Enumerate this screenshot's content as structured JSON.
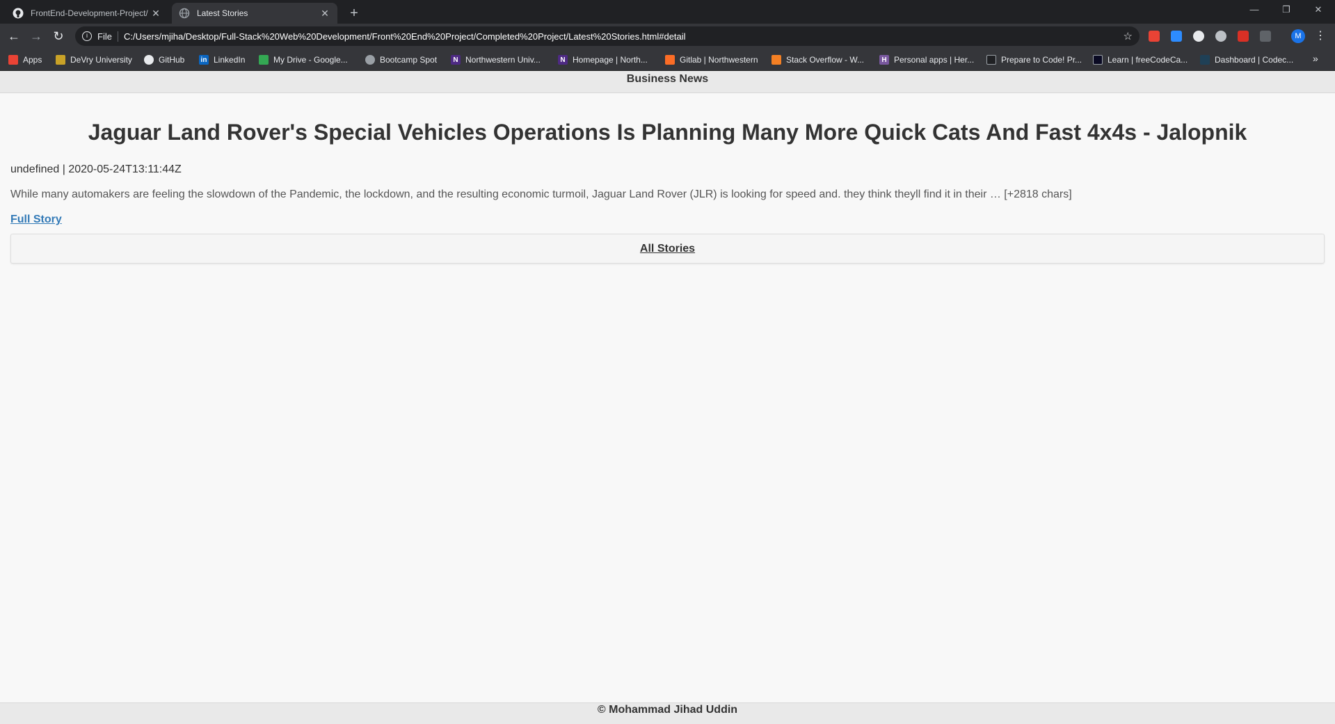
{
  "browser": {
    "tabs": [
      {
        "title": "FrontEnd-Development-Project/",
        "active": false
      },
      {
        "title": "Latest Stories",
        "active": true
      }
    ],
    "new_tab": "+",
    "window_controls": {
      "minimize": "—",
      "restore": "❐",
      "close": "✕"
    },
    "address": {
      "scheme": "File",
      "url": "C:/Users/mjiha/Desktop/Full-Stack%20Web%20Development/Front%20End%20Project/Completed%20Project/Latest%20Stories.html#detail"
    },
    "profile_initial": "M",
    "bookmarks": [
      {
        "label": "Apps",
        "icon": "apps-grid-icon",
        "color": "#ea4335"
      },
      {
        "label": "DeVry University",
        "icon": "devry-shield-icon",
        "color": "#c9a227"
      },
      {
        "label": "GitHub",
        "icon": "github-icon",
        "color": "#ffffff"
      },
      {
        "label": "LinkedIn",
        "icon": "linkedin-icon",
        "color": "#0a66c2"
      },
      {
        "label": "My Drive - Google...",
        "icon": "google-drive-icon",
        "color": "#34a853"
      },
      {
        "label": "Bootcamp Spot",
        "icon": "globe-icon",
        "color": "#9aa0a6"
      },
      {
        "label": "Northwestern Univ...",
        "icon": "northwestern-n-icon",
        "color": "#4e2a84"
      },
      {
        "label": "Homepage | North...",
        "icon": "northwestern-n-icon",
        "color": "#4e2a84"
      },
      {
        "label": "Gitlab | Northwestern",
        "icon": "gitlab-icon",
        "color": "#fc6d26"
      },
      {
        "label": "Stack Overflow - W...",
        "icon": "stackoverflow-icon",
        "color": "#f48024"
      },
      {
        "label": "Personal apps | Her...",
        "icon": "heroku-icon",
        "color": "#79589f"
      },
      {
        "label": "Prepare to Code! Pr...",
        "icon": "book-icon",
        "color": "#202124"
      },
      {
        "label": "Learn | freeCodeCa...",
        "icon": "freecodecamp-icon",
        "color": "#0a0a23"
      },
      {
        "label": "Dashboard | Codec...",
        "icon": "codecademy-icon",
        "color": "#1f4056"
      }
    ],
    "bookmarks_more": "»"
  },
  "page": {
    "header_title": "Business News",
    "article": {
      "headline": "Jaguar Land Rover's Special Vehicles Operations Is Planning Many More Quick Cats And Fast 4x4s - Jalopnik",
      "meta": "undefined | 2020-05-24T13:11:44Z",
      "description": "While many automakers are feeling the slowdown of the Pandemic, the lockdown, and the resulting economic turmoil, Jaguar Land Rover (JLR) is looking for speed and. they think theyll find it in their … [+2818 chars]",
      "full_story_label": "Full Story"
    },
    "all_stories_label": "All Stories",
    "footer_text": "© Mohammad Jihad Uddin"
  }
}
